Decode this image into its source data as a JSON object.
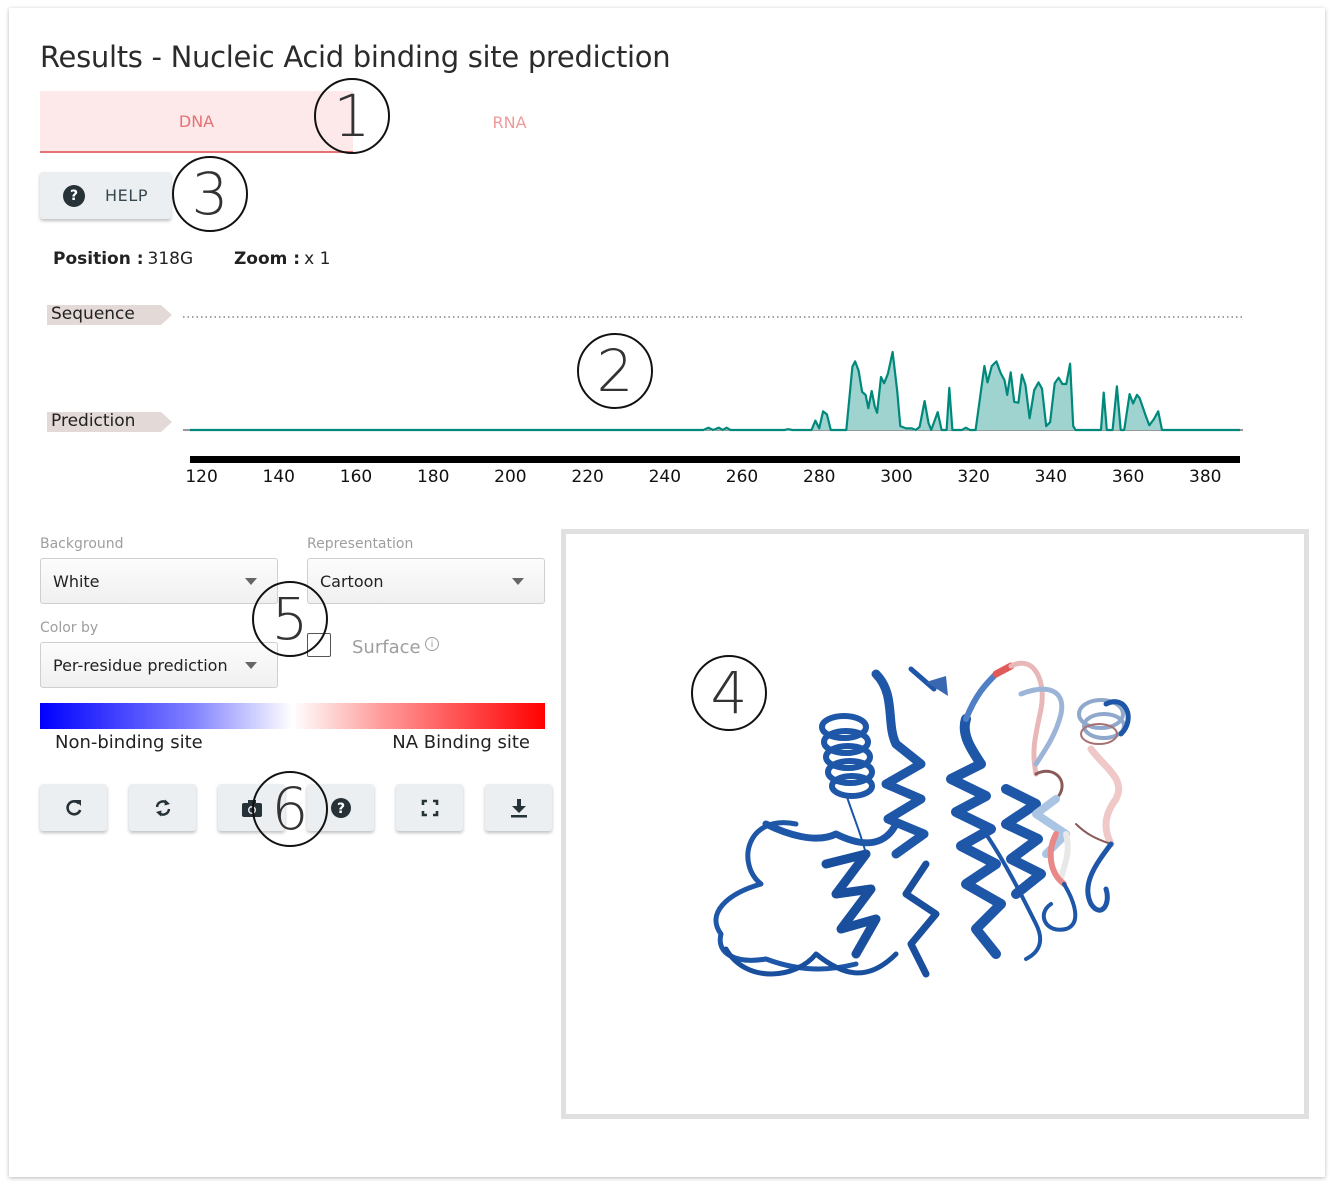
{
  "page": {
    "title": "Results - Nucleic Acid binding site prediction"
  },
  "tabs": [
    {
      "label": "DNA",
      "active": true
    },
    {
      "label": "RNA",
      "active": false
    }
  ],
  "help_button": {
    "label": "HELP",
    "icon": "question-circle-icon"
  },
  "status": {
    "position_label": "Position :",
    "position_value": "318G",
    "zoom_label": "Zoom :",
    "zoom_value": "x 1"
  },
  "tracks": {
    "sequence_label": "Sequence",
    "prediction_label": "Prediction"
  },
  "chart_data": {
    "type": "area",
    "title": "",
    "xlabel": "",
    "ylabel": "",
    "x_ticks": [
      120,
      140,
      160,
      180,
      200,
      220,
      240,
      260,
      280,
      300,
      320,
      340,
      360,
      380
    ],
    "xlim": [
      117,
      389
    ],
    "ylim": [
      0,
      1
    ],
    "grid": false,
    "color": "#00897b",
    "fill": "#9fd3d0",
    "series": [
      {
        "name": "Prediction",
        "points": [
          [
            117,
            0
          ],
          [
            250,
            0
          ],
          [
            251.3,
            0.03
          ],
          [
            252.5,
            0
          ],
          [
            254,
            0.03
          ],
          [
            255,
            0
          ],
          [
            256,
            0.03
          ],
          [
            257,
            0
          ],
          [
            271,
            0
          ],
          [
            272,
            0.01
          ],
          [
            273,
            0
          ],
          [
            278,
            0
          ],
          [
            279,
            0.12
          ],
          [
            280,
            0.02
          ],
          [
            281,
            0.24
          ],
          [
            282,
            0.2
          ],
          [
            283,
            0
          ],
          [
            287,
            0
          ],
          [
            288.6,
            0.81
          ],
          [
            289.3,
            0.88
          ],
          [
            290.2,
            0.76
          ],
          [
            291.1,
            0.49
          ],
          [
            292,
            0.45
          ],
          [
            292.7,
            0.28
          ],
          [
            293.6,
            0.5
          ],
          [
            294.4,
            0.3
          ],
          [
            295,
            0.22
          ],
          [
            296,
            0.68
          ],
          [
            296.8,
            0.6
          ],
          [
            297.8,
            0.72
          ],
          [
            299,
            1.0
          ],
          [
            300.2,
            0.5
          ],
          [
            301,
            0.05
          ],
          [
            302.5,
            0.02
          ],
          [
            304,
            0.02
          ],
          [
            305,
            0
          ],
          [
            306,
            0.04
          ],
          [
            307.3,
            0.37
          ],
          [
            308.3,
            0.09
          ],
          [
            309,
            0
          ],
          [
            310.7,
            0.23
          ],
          [
            311.7,
            0.0
          ],
          [
            313,
            0.0
          ],
          [
            313.7,
            0.54
          ],
          [
            314.5,
            0.0
          ],
          [
            317,
            0
          ],
          [
            318,
            0.03
          ],
          [
            319,
            0
          ],
          [
            320.5,
            0
          ],
          [
            322.8,
            0.82
          ],
          [
            323.6,
            0.61
          ],
          [
            324.7,
            0.82
          ],
          [
            325.9,
            0.88
          ],
          [
            327,
            0.73
          ],
          [
            328,
            0.64
          ],
          [
            328.7,
            0.45
          ],
          [
            329.6,
            0.74
          ],
          [
            330.5,
            0.36
          ],
          [
            331.6,
            0.35
          ],
          [
            332.5,
            0.71
          ],
          [
            333.4,
            0.58
          ],
          [
            334.5,
            0.15
          ],
          [
            335.7,
            0.51
          ],
          [
            336.8,
            0.61
          ],
          [
            337.7,
            0.53
          ],
          [
            338.8,
            0.05
          ],
          [
            339.8,
            0.1
          ],
          [
            341,
            0.6
          ],
          [
            342,
            0.67
          ],
          [
            343,
            0.59
          ],
          [
            344,
            0.59
          ],
          [
            345,
            0.85
          ],
          [
            345.8,
            0.05
          ],
          [
            346.4,
            0
          ],
          [
            353,
            0
          ],
          [
            353.7,
            0.48
          ],
          [
            354.5,
            0
          ],
          [
            356,
            0
          ],
          [
            357.1,
            0.56
          ],
          [
            358.1,
            0
          ],
          [
            359,
            0
          ],
          [
            360.4,
            0.46
          ],
          [
            361.3,
            0.34
          ],
          [
            362.3,
            0.45
          ],
          [
            363,
            0.41
          ],
          [
            364.6,
            0.18
          ],
          [
            365.5,
            0.06
          ],
          [
            366.7,
            0.14
          ],
          [
            367.8,
            0.24
          ],
          [
            368.8,
            0
          ],
          [
            389,
            0
          ]
        ]
      }
    ]
  },
  "controls": {
    "background": {
      "label": "Background",
      "value": "White"
    },
    "representation": {
      "label": "Representation",
      "value": "Cartoon"
    },
    "color_by": {
      "label": "Color by",
      "value": "Per-residue prediction"
    },
    "surface": {
      "label": "Surface",
      "checked": false
    }
  },
  "legend": {
    "left_label": "Non-binding site",
    "right_label": "NA Binding site",
    "colors": [
      "#0000ff",
      "#ffffff",
      "#ff0000"
    ]
  },
  "toolbar": [
    {
      "name": "reset-view",
      "icon": "redo-icon"
    },
    {
      "name": "spin",
      "icon": "sync-icon"
    },
    {
      "name": "screenshot",
      "icon": "camera-icon"
    },
    {
      "name": "viewer-help",
      "icon": "question-circle-icon"
    },
    {
      "name": "fullscreen",
      "icon": "expand-icon"
    },
    {
      "name": "download",
      "icon": "download-icon"
    }
  ],
  "annotations": [
    "1",
    "2",
    "3",
    "4",
    "5",
    "6"
  ]
}
